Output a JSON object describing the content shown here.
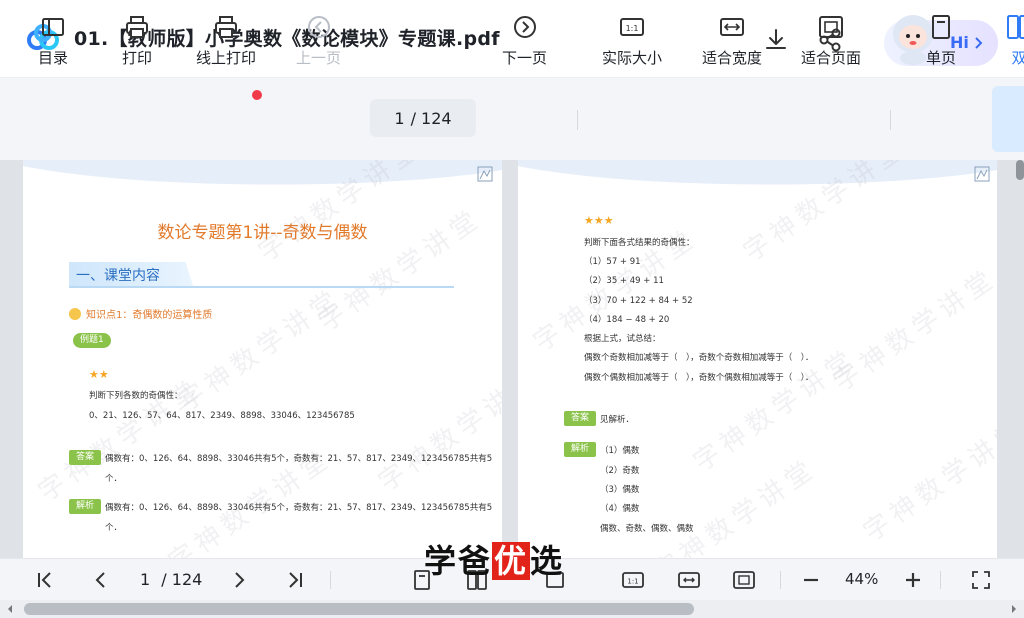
{
  "header": {
    "title": "01.【教师版】小学奥数《数论模块》专题课.pdf",
    "assistant_label": "Hi"
  },
  "toolbar": {
    "items": [
      {
        "label": "目录",
        "icon": "toc-icon"
      },
      {
        "label": "打印",
        "icon": "printer-icon"
      },
      {
        "label": "线上打印",
        "icon": "online-printer-icon"
      },
      {
        "label": "上一页",
        "icon": "prev-page-icon"
      },
      {
        "label": "下一页",
        "icon": "next-page-icon"
      },
      {
        "label": "实际大小",
        "icon": "actual-size-icon"
      },
      {
        "label": "适合宽度",
        "icon": "fit-width-icon"
      },
      {
        "label": "适合页面",
        "icon": "fit-page-icon"
      },
      {
        "label": "单页",
        "icon": "single-page-icon"
      },
      {
        "label": "双",
        "icon": "double-page-icon"
      }
    ],
    "page_current": "1",
    "page_total": "/ 124"
  },
  "page_left": {
    "title": "数论专题第1讲--奇数与偶数",
    "section": "一、课堂内容",
    "knowledge_point": "知识点1：奇偶数的运算性质",
    "example_tag": "例题1",
    "stars": "★★",
    "question": "判断下列各数的奇偶性：",
    "numbers": "0、21、126、57、64、817、2349、8898、33046、123456785",
    "answer_tag": "答案",
    "answer_line1": "偶数有：0、126、64、8898、33046共有5个，奇数有：21、57、817、2349、123456785共有5",
    "answer_line2": "个．",
    "analysis_tag": "解析",
    "analysis_line1": "偶数有：0、126、64、8898、33046共有5个，奇数有：21、57、817、2349、123456785共有5",
    "analysis_line2": "个．"
  },
  "page_right": {
    "stars": "★★★",
    "question": "判断下面各式结果的奇偶性：",
    "items": [
      "（1）57 + 91",
      "（2）35 + 49 + 11",
      "（3）70 + 122 + 84 + 52",
      "（4）184 − 48 + 20"
    ],
    "summary_intro": "根据上式，试总结：",
    "summary_line1": "偶数个奇数相加减等于（　），奇数个奇数相加减等于（　）．",
    "summary_line2": "偶数个偶数相加减等于（　），奇数个偶数相加减等于（　）．",
    "answer_tag": "答案",
    "answer_text": "见解析．",
    "analysis_tag": "解析",
    "analysis_items": [
      "（1）偶数",
      "（2）奇数",
      "（3）偶数",
      "（4）偶数"
    ],
    "analysis_summary": "偶数、奇数、偶数、偶数"
  },
  "watermark": "字神数学讲堂",
  "bottom_bar": {
    "page_current": "1",
    "page_total": "/ 124",
    "zoom": "44%"
  },
  "brand_watermark": {
    "before": "学爸",
    "highlight": "优",
    "after": "选"
  }
}
